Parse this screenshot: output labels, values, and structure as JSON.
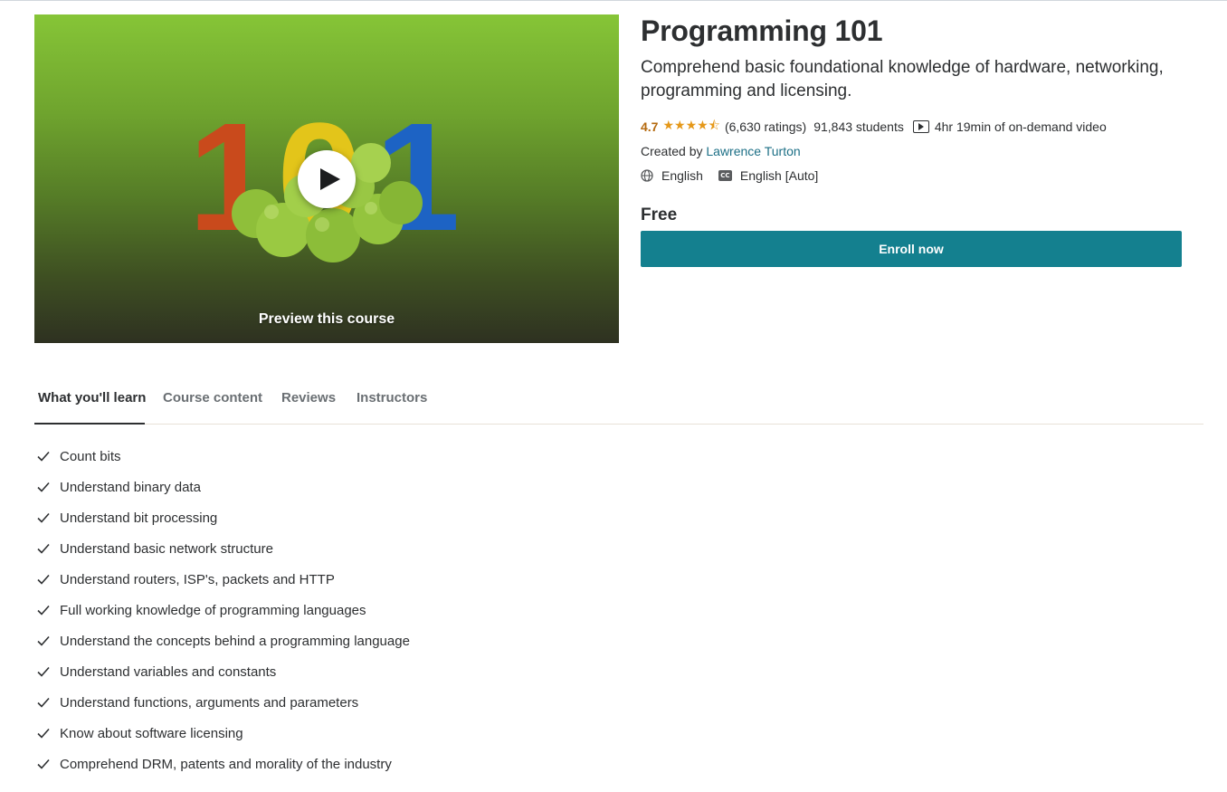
{
  "course": {
    "title": "Programming 101",
    "subtitle": "Comprehend basic foundational knowledge of hardware, networking, programming and licensing.",
    "rating": "4.7",
    "stars": "★★★★⯪",
    "rating_value": 4.5,
    "rating_count": "(6,630 ratings)",
    "students": "91,843 students",
    "video_length": "4hr 19min of on-demand video",
    "created_by_label": "Created by",
    "instructor": "Lawrence Turton",
    "language": "English",
    "captions": "English [Auto]",
    "cc_badge": "CC",
    "price": "Free",
    "enroll_label": "Enroll now"
  },
  "preview": {
    "label": "Preview this course",
    "thumbnail_text": "101"
  },
  "tabs": [
    {
      "label": "What you'll learn",
      "active": true
    },
    {
      "label": "Course content",
      "active": false
    },
    {
      "label": "Reviews",
      "active": false
    },
    {
      "label": "Instructors",
      "active": false
    }
  ],
  "learn_items": [
    "Count bits",
    "Understand binary data",
    "Understand bit processing",
    "Understand basic network structure",
    "Understand routers, ISP's, packets and HTTP",
    "Full working knowledge of programming languages",
    "Understand the concepts behind a programming language",
    "Understand variables and constants",
    "Understand functions, arguments and parameters",
    "Know about software licensing",
    "Comprehend DRM, patents and morality of the industry"
  ],
  "icons": {
    "play": "play-icon",
    "star": "star-icon",
    "video": "video-icon",
    "globe": "globe-icon",
    "cc": "closed-captions-icon",
    "check": "check-icon"
  },
  "colors": {
    "accent_button": "#14808f",
    "rating_text": "#b4690e",
    "star": "#e59819",
    "link": "#1c6f86",
    "text": "#2d2f31"
  }
}
